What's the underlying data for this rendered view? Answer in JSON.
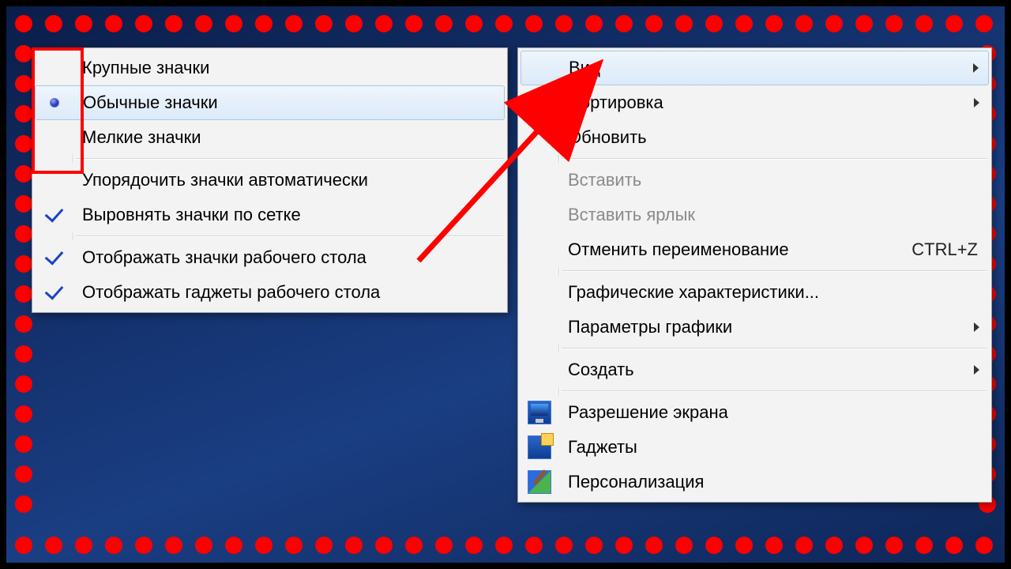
{
  "context_menu": {
    "items": [
      {
        "label": "Вид",
        "submenu": true,
        "highlighted": true
      },
      {
        "label": "Сортировка",
        "submenu": true
      },
      {
        "label": "Обновить"
      },
      {
        "sep": true
      },
      {
        "label": "Вставить",
        "disabled": true
      },
      {
        "label": "Вставить ярлык",
        "disabled": true
      },
      {
        "label": "Отменить переименование",
        "shortcut": "CTRL+Z"
      },
      {
        "sep": true
      },
      {
        "label": "Графические характеристики..."
      },
      {
        "label": "Параметры графики",
        "submenu": true
      },
      {
        "sep": true
      },
      {
        "label": "Создать",
        "submenu": true
      },
      {
        "sep": true
      },
      {
        "label": "Разрешение экрана",
        "icon": "resolution"
      },
      {
        "label": "Гаджеты",
        "icon": "gadgets"
      },
      {
        "label": "Персонализация",
        "icon": "personalize"
      }
    ]
  },
  "view_submenu": {
    "items": [
      {
        "label": "Крупные значки",
        "type": "radio",
        "checked": false
      },
      {
        "label": "Обычные значки",
        "type": "radio",
        "checked": true,
        "highlighted": true
      },
      {
        "label": "Мелкие значки",
        "type": "radio",
        "checked": false
      },
      {
        "sep": true
      },
      {
        "label": "Упорядочить значки автоматически",
        "type": "check",
        "checked": false
      },
      {
        "label": "Выровнять значки по сетке",
        "type": "check",
        "checked": true
      },
      {
        "sep": true
      },
      {
        "label": "Отображать значки рабочего стола",
        "type": "check",
        "checked": true
      },
      {
        "label": "Отображать гаджеты  рабочего стола",
        "type": "check",
        "checked": true
      }
    ]
  }
}
